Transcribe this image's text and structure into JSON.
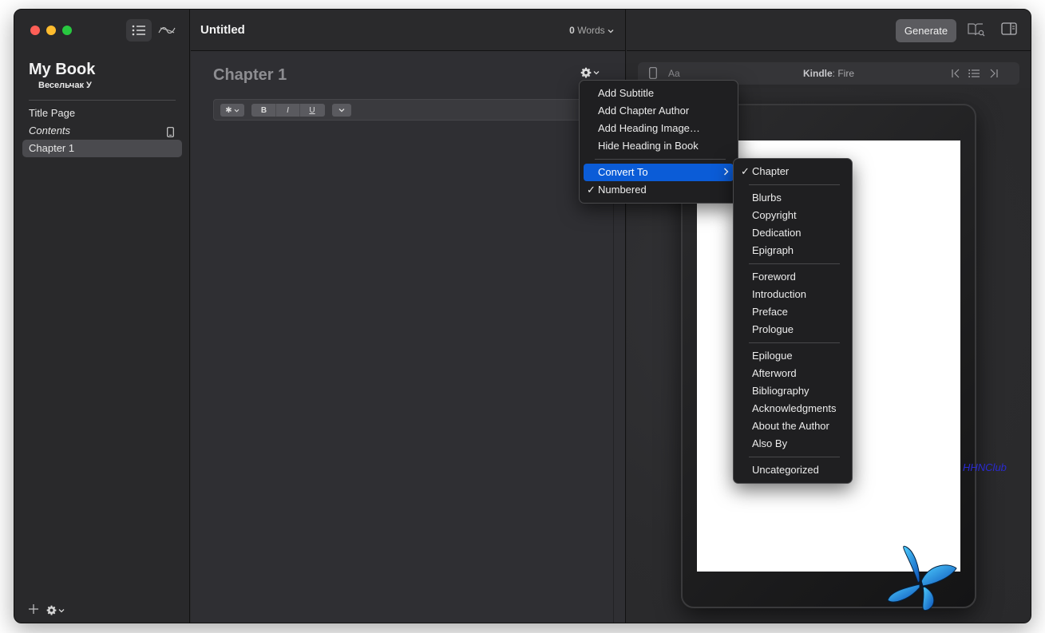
{
  "sidebar": {
    "book_title": "My Book",
    "book_author": "Весельчак У",
    "items": [
      {
        "label": "Title Page",
        "italic": false,
        "selected": false
      },
      {
        "label": "Contents",
        "italic": true,
        "selected": false,
        "icon": "device-icon"
      },
      {
        "label": "Chapter 1",
        "italic": false,
        "selected": true
      }
    ],
    "bottom": {
      "add_icon": "plus-icon",
      "settings_icon": "gear-icon"
    }
  },
  "editor": {
    "doc_title": "Untitled",
    "word_count": "0",
    "word_label": "Words",
    "chapter_heading": "Chapter 1",
    "format_buttons": {
      "style": "✱",
      "bold": "B",
      "italic": "I",
      "underline": "U"
    }
  },
  "preview": {
    "generate_label": "Generate",
    "device_prefix": "Kindle",
    "device_name": "Fire",
    "font_label": "Aa",
    "watermark": "HHNClub"
  },
  "heading_menu": {
    "items": [
      {
        "label": "Add Subtitle"
      },
      {
        "label": "Add Chapter Author"
      },
      {
        "label": "Add Heading Image…"
      },
      {
        "label": "Hide Heading in Book"
      }
    ],
    "convert_to": "Convert To",
    "numbered": "Numbered"
  },
  "convert_menu": {
    "chapter": "Chapter",
    "group_front": [
      "Blurbs",
      "Copyright",
      "Dedication",
      "Epigraph"
    ],
    "group_intro": [
      "Foreword",
      "Introduction",
      "Preface",
      "Prologue"
    ],
    "group_back": [
      "Epilogue",
      "Afterword",
      "Bibliography",
      "Acknowledgments",
      "About the Author",
      "Also By"
    ],
    "uncategorized": "Uncategorized"
  },
  "colors": {
    "accent": "#0b5cd7",
    "window_bg": "#2a2a2c"
  }
}
